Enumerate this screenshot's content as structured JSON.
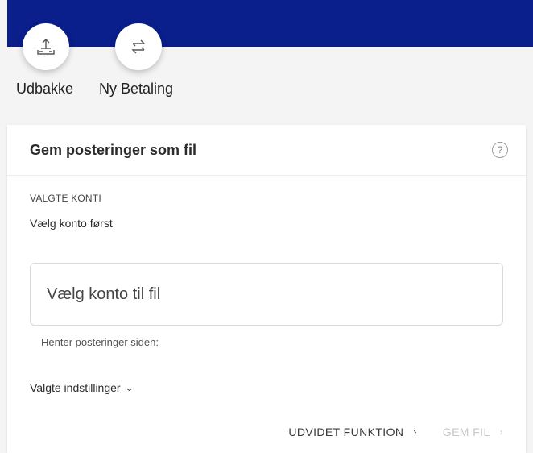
{
  "shortcuts": [
    {
      "label": "Udbakke",
      "icon": "outbox-icon"
    },
    {
      "label": "Ny Betaling",
      "icon": "transfer-arrows-icon"
    }
  ],
  "card": {
    "title": "Gem posteringer som fil",
    "help_icon": "?",
    "selected_accounts": {
      "label": "VALGTE KONTI",
      "value": "Vælg konto først"
    },
    "account_select": {
      "placeholder": "Vælg konto til fil",
      "helper": "Henter posteringer siden:"
    },
    "settings_toggle": {
      "label": "Valgte indstillinger",
      "icon": "⌄"
    },
    "actions": {
      "advanced": {
        "label": "UDVIDET FUNKTION",
        "arrow": "›"
      },
      "save": {
        "label": "GEM FIL",
        "arrow": "›",
        "disabled": true
      }
    }
  },
  "colors": {
    "topbar": "#0a1e8c",
    "background": "#f4f4f4",
    "card": "#ffffff",
    "disabled_text": "#c7c7c7"
  }
}
